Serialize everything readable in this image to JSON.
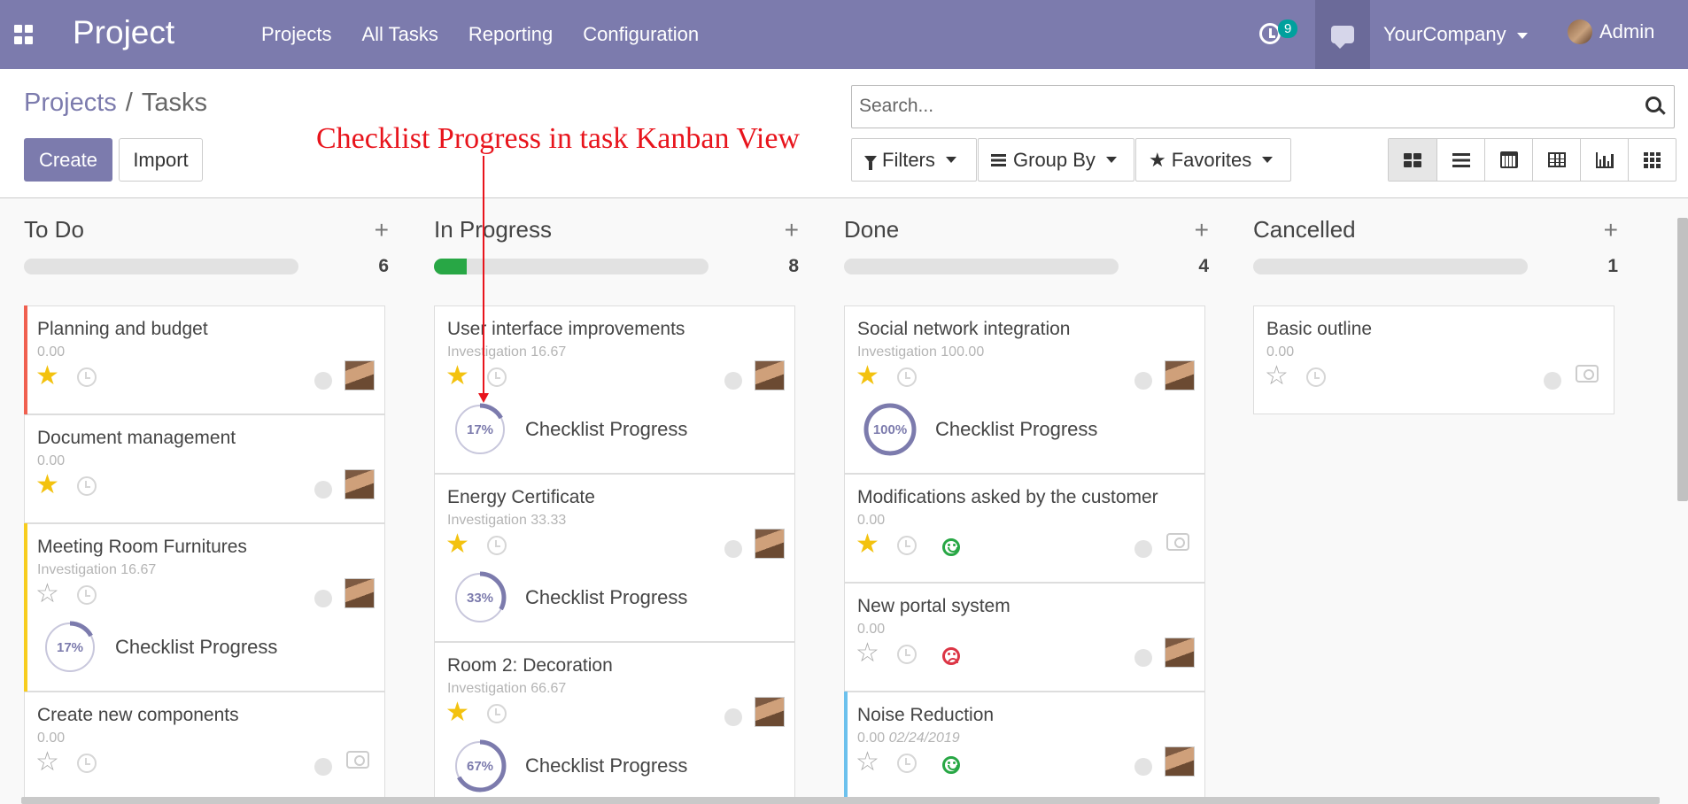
{
  "navbar": {
    "app_title": "Project",
    "menu": [
      "Projects",
      "All Tasks",
      "Reporting",
      "Configuration"
    ],
    "activity_count": "9",
    "company": "YourCompany",
    "user": "Admin"
  },
  "breadcrumb": {
    "parent": "Projects",
    "current": "Tasks"
  },
  "buttons": {
    "create": "Create",
    "import": "Import"
  },
  "search": {
    "placeholder": "Search..."
  },
  "filters": {
    "filters": "Filters",
    "group_by": "Group By",
    "favorites": "Favorites"
  },
  "annotation": "Checklist Progress in task Kanban View",
  "icons": {
    "apps": "apps-grid-icon",
    "activity": "clock-icon",
    "chat": "chat-icon",
    "search": "search-icon",
    "views": [
      "kanban-view-icon",
      "list-view-icon",
      "calendar-view-icon",
      "table-view-icon",
      "graph-view-icon",
      "pivot-view-icon"
    ]
  },
  "colors": {
    "brand": "#7c7bad",
    "progress_green": "#28a745",
    "star": "#f3c20f",
    "annotation": "#e8141c"
  },
  "columns": [
    {
      "title": "To Do",
      "count": "6",
      "progress": 0,
      "cards": [
        {
          "title": "Planning and budget",
          "subtitle": "0.00",
          "date": "",
          "starred": true,
          "left_color": "#f06050",
          "photo": true,
          "smile": "",
          "progress": null
        },
        {
          "title": "Document management",
          "subtitle": "0.00",
          "date": "",
          "starred": true,
          "left_color": "",
          "photo": true,
          "smile": "",
          "progress": null
        },
        {
          "title": "Meeting Room Furnitures",
          "subtitle": "Investigation 16.67",
          "date": "",
          "starred": false,
          "left_color": "#f7cd1f",
          "photo": true,
          "smile": "",
          "progress": 17
        },
        {
          "title": "Create new components",
          "subtitle": "0.00",
          "date": "",
          "starred": false,
          "left_color": "",
          "photo": false,
          "smile": "",
          "progress": null
        }
      ]
    },
    {
      "title": "In Progress",
      "count": "8",
      "progress": 0.12,
      "cards": [
        {
          "title": "User interface improvements",
          "subtitle": "Investigation 16.67",
          "date": "",
          "starred": true,
          "left_color": "",
          "photo": true,
          "smile": "",
          "progress": 17
        },
        {
          "title": "Energy Certificate",
          "subtitle": "Investigation 33.33",
          "date": "",
          "starred": true,
          "left_color": "",
          "photo": true,
          "smile": "",
          "progress": 33
        },
        {
          "title": "Room 2: Decoration",
          "subtitle": "Investigation 66.67",
          "date": "",
          "starred": true,
          "left_color": "",
          "photo": true,
          "smile": "",
          "progress": 67
        }
      ]
    },
    {
      "title": "Done",
      "count": "4",
      "progress": 0,
      "cards": [
        {
          "title": "Social network integration",
          "subtitle": "Investigation 100.00",
          "date": "",
          "starred": true,
          "left_color": "",
          "photo": true,
          "smile": "",
          "progress": 100
        },
        {
          "title": "Modifications asked by the customer",
          "subtitle": "0.00",
          "date": "",
          "starred": true,
          "left_color": "",
          "photo": false,
          "smile": "happy",
          "progress": null
        },
        {
          "title": "New portal system",
          "subtitle": "0.00",
          "date": "",
          "starred": false,
          "left_color": "",
          "photo": true,
          "smile": "sad",
          "progress": null
        },
        {
          "title": "Noise Reduction",
          "subtitle": "0.00",
          "date": "02/24/2019",
          "starred": false,
          "left_color": "#6cc1ed",
          "photo": true,
          "smile": "happy",
          "progress": null
        }
      ]
    },
    {
      "title": "Cancelled",
      "count": "1",
      "progress": 0,
      "cards": [
        {
          "title": "Basic outline",
          "subtitle": "0.00",
          "date": "",
          "starred": false,
          "left_color": "",
          "photo": false,
          "smile": "",
          "progress": null
        }
      ]
    }
  ],
  "checklist_label": "Checklist Progress"
}
